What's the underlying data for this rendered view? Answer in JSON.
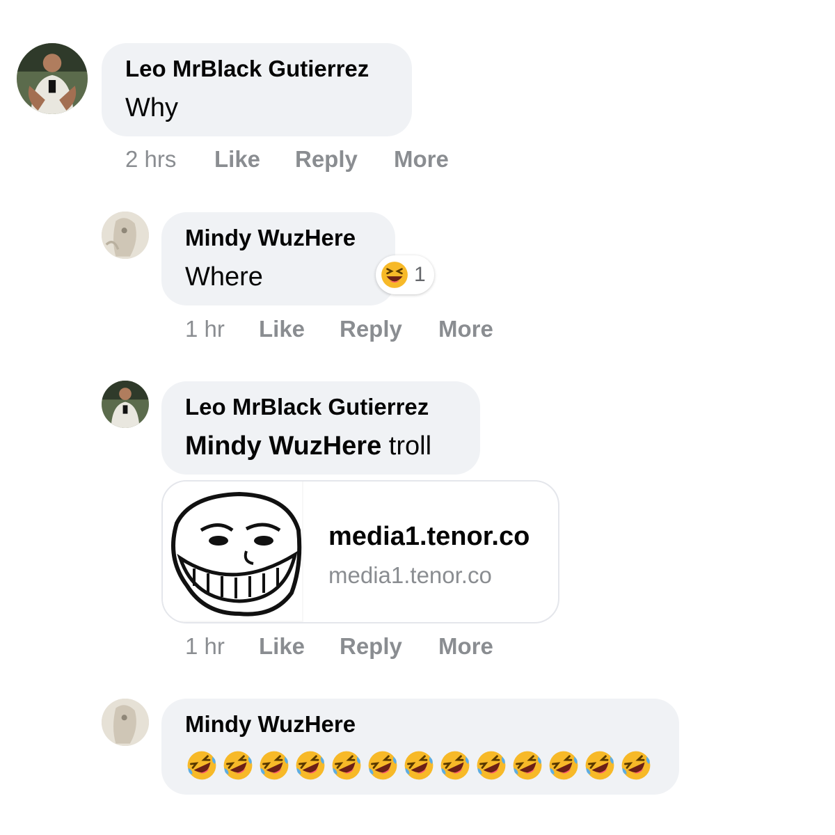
{
  "comments": [
    {
      "author": "Leo MrBlack Gutierrez",
      "text": "Why",
      "time": "2 hrs",
      "like": "Like",
      "reply": "Reply",
      "more": "More"
    },
    {
      "author": "Mindy WuzHere",
      "text": "Where",
      "reaction": {
        "icon": "laughing-emoji",
        "count": "1"
      },
      "time": "1 hr",
      "like": "Like",
      "reply": "Reply",
      "more": "More"
    },
    {
      "author": "Leo MrBlack Gutierrez",
      "mention": "Mindy WuzHere",
      "text": " troll",
      "link": {
        "title": "media1.tenor.co",
        "domain": "media1.tenor.co",
        "thumbnail": "troll-face"
      },
      "time": "1 hr",
      "like": "Like",
      "reply": "Reply",
      "more": "More"
    },
    {
      "author": "Mindy WuzHere",
      "emoji": {
        "icon": "rolling-on-floor-laughing-emoji",
        "count": 13
      }
    }
  ],
  "colors": {
    "bubble": "#f0f2f5",
    "meta": "#8a8d91",
    "text": "#050505",
    "emoji": "#f7b928"
  }
}
